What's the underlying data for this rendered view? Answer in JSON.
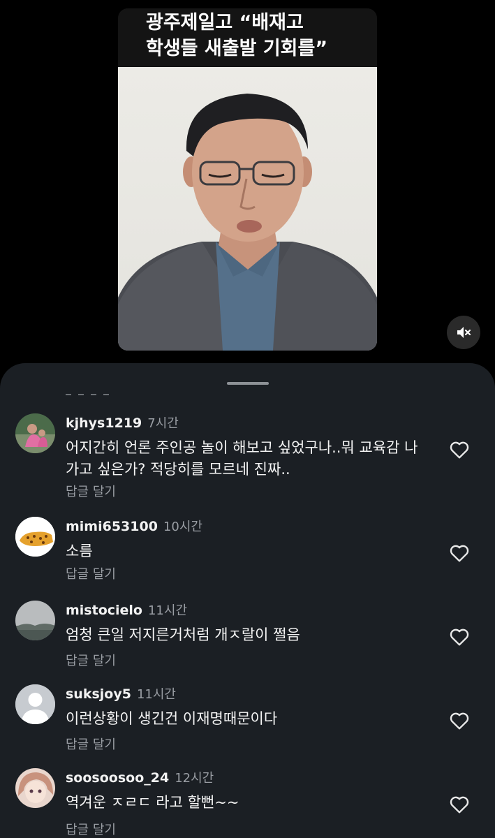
{
  "video": {
    "caption_lines": [
      "광주제일고 “배재고",
      "학생들 새출발 기회를”"
    ],
    "mute_icon": "speaker-muted-icon"
  },
  "comments_sheet": {
    "reply_label": "답글 달기",
    "like_icon": "heart-outline-icon",
    "comments": [
      {
        "user": "kjhys1219",
        "time": "7시간",
        "text": "어지간히 언론 주인공 놀이 해보고 싶었구나..뭐 교육감 나가고 싶은가? 적당히를 모르네 진짜..",
        "avatar": "photo-avatar"
      },
      {
        "user": "mimi653100",
        "time": "10시간",
        "text": "소름",
        "avatar": "leopard-avatar"
      },
      {
        "user": "mistocielo",
        "time": "11시간",
        "text": "엄청 큰일 저지른거처럼 개ㅈ랄이 쩔음",
        "avatar": "landscape-avatar"
      },
      {
        "user": "suksjoy5",
        "time": "11시간",
        "text": "이런상황이 생긴건 이재명때문이다",
        "avatar": "default-avatar"
      },
      {
        "user": "soosoosoo_24",
        "time": "12시간",
        "text": "역겨운 ㅈㄹㄷ 라고 할뻔~~",
        "avatar": "anime-avatar"
      }
    ]
  },
  "colors": {
    "background": "#000000",
    "sheet": "#1b1f24",
    "secondary_text": "#9a9ea4",
    "primary_text": "#f2f2f2"
  }
}
